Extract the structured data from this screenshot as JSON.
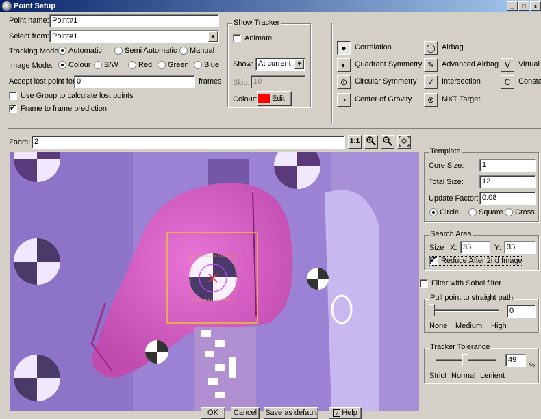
{
  "window": {
    "title": "Point Setup",
    "controls": [
      "_",
      "□",
      "x"
    ]
  },
  "point_name": {
    "label": "Point name:",
    "value": "Point#1"
  },
  "select_from": {
    "label": "Select from:",
    "value": "Point#1"
  },
  "tracking_mode": {
    "label": "Tracking Mode:",
    "options": [
      "Automatic",
      "Semi Automatic",
      "Manual"
    ],
    "selected": "Automatic"
  },
  "image_mode": {
    "label": "Image Mode:",
    "options": [
      "Colour",
      "B/W",
      "Red",
      "Green",
      "Blue"
    ],
    "selected": "Colour"
  },
  "accept_lost": {
    "label": "Accept lost point for",
    "value": "0",
    "suffix": "frames"
  },
  "use_group": {
    "label": "Use Group to calculate lost points",
    "checked": false
  },
  "frame_prediction": {
    "label": "Frame to frame prediction",
    "checked": true
  },
  "show_tracker": {
    "title": "Show Tracker",
    "animate": {
      "label": "Animate",
      "checked": false
    },
    "show_label": "Show:",
    "show_value": "At current ...",
    "skip_label": "Skip:",
    "skip_value": "10",
    "colour_label": "Colour:",
    "edit_label": "Edit...",
    "colour": "#ff0000"
  },
  "methods": [
    {
      "label": "Correlation",
      "icon": "dot-circle-icon",
      "pressed": true
    },
    {
      "label": "Quadrant Symmetry",
      "icon": "quadrant-icon",
      "pressed": false
    },
    {
      "label": "Circular Symmetry",
      "icon": "circle-dot-icon",
      "pressed": false
    },
    {
      "label": "Center of Gravity",
      "icon": "gravity-icon",
      "pressed": false
    },
    {
      "label": "Airbag",
      "icon": "airbag-icon",
      "pressed": false
    },
    {
      "label": "Advanced Airbag",
      "icon": "advanced-airbag-icon",
      "pressed": false
    },
    {
      "label": "Intersection",
      "icon": "intersection-icon",
      "pressed": false
    },
    {
      "label": "MXT Target",
      "icon": "mxt-target-icon",
      "pressed": false
    },
    {
      "label": "Virtual",
      "icon": "virtual-icon",
      "pressed": false
    },
    {
      "label": "Constan",
      "icon": "constant-icon",
      "pressed": false
    }
  ],
  "zoom": {
    "label": "Zoom:",
    "value": "2",
    "buttons": [
      "1:1",
      "zoom-in",
      "zoom-out",
      "fit"
    ]
  },
  "template": {
    "title": "Template",
    "core_size_label": "Core Size:",
    "core_size": "1",
    "total_size_label": "Total Size:",
    "total_size": "12",
    "update_factor_label": "Update Factor:",
    "update_factor": "0.08",
    "shapes": [
      "Circle",
      "Square",
      "Cross"
    ],
    "shape_selected": "Circle"
  },
  "search_area": {
    "title": "Search Area",
    "size_label": "Size",
    "x_label": "X:",
    "x": "35",
    "y_label": "Y:",
    "y": "35",
    "reduce_label": "Reduce After 2nd Image",
    "reduce_checked": true
  },
  "sobel": {
    "label": "Filter with Sobel filter",
    "checked": false
  },
  "pull_point": {
    "title": "Pull point to straight path",
    "value": "0",
    "level": 0.0,
    "ticks": [
      "None",
      "Medium",
      "High"
    ]
  },
  "tracker_tolerance": {
    "title": "Tracker Tolerance",
    "value": "49",
    "unit": "%",
    "level": 0.49,
    "ticks": [
      "Strict",
      "Normal",
      "Lenient"
    ]
  },
  "footer": {
    "ok": "OK",
    "cancel": "Cancel",
    "save_default": "Save as default",
    "help": "Help"
  }
}
